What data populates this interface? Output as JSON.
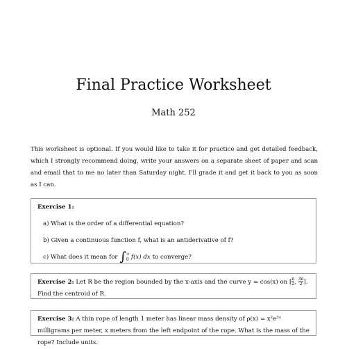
{
  "header": {
    "title": "Final Practice Worksheet",
    "subtitle": "Math 252"
  },
  "intro": {
    "text": "This worksheet is optional. If you would like to take it for practice and get detailed feedback, which I strongly recommend doing, write your answers on a separate sheet of paper and scan and email that to me no later than Saturday night. I'll grade it and get it back to you as soon as I can."
  },
  "exercise1": {
    "label": "Exercise 1:",
    "item_a": "a) What is the order of a differential equation?",
    "item_b": "b) Given a continuous function f, what is an antiderivative of f?",
    "item_c_prefix": "c) What does it mean for",
    "item_c_lower": "0",
    "item_c_upper": "∞",
    "item_c_integrand": "f(x) dx",
    "item_c_suffix": "to converge?"
  },
  "exercise2": {
    "label": "Exercise 2:",
    "text_before": "Let R be the region bounded by the x-axis and the curve y = cos(x) on",
    "interval_open": "[",
    "frac1_num": "π",
    "frac1_den": "2",
    "interval_sep": ",",
    "frac2_num": "3π",
    "frac2_den": "2",
    "interval_close": "]",
    "text_after": ". Find the centroid of R."
  },
  "exercise3": {
    "label": "Exercise 3:",
    "text": "A thin rope of length 1 meter has linear mass density of ρ(x) = x²e³ˣ milligrams per meter, x meters from the left endpoint of the rope. What is the mass of the rope? Include units."
  }
}
